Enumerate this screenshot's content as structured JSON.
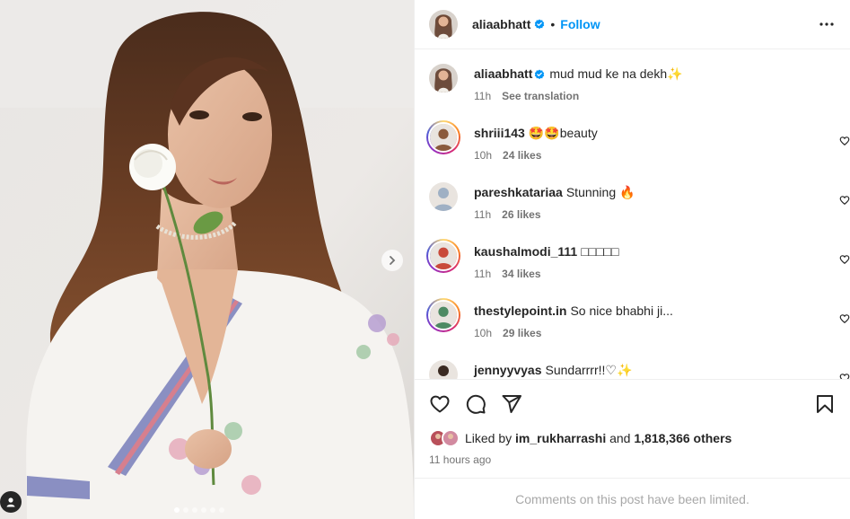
{
  "post": {
    "author": "aliaabhatt",
    "follow_label": "Follow",
    "separator": "•",
    "caption_text": "mud mud ke na dekh",
    "caption_emoji": "✨",
    "caption_time": "11h",
    "see_translation": "See translation",
    "carousel": {
      "slide_count": 6,
      "active_index": 0
    }
  },
  "comments": [
    {
      "user": "shriii143",
      "text": "🤩🤩beauty",
      "time": "10h",
      "likes": "24 likes",
      "story_ring": true,
      "av": "#8a5a3c"
    },
    {
      "user": "pareshkatariaa",
      "text": "Stunning 🔥",
      "time": "11h",
      "likes": "26 likes",
      "story_ring": false,
      "av": "#9fb0c4"
    },
    {
      "user": "kaushalmodi_111",
      "text": "□□□□□",
      "time": "11h",
      "likes": "34 likes",
      "story_ring": true,
      "av": "#c94a3a"
    },
    {
      "user": "thestylepoint.in",
      "text": "So nice bhabhi ji...",
      "time": "10h",
      "likes": "29 likes",
      "story_ring": true,
      "av": "#4e8a63"
    },
    {
      "user": "jennyyvyas",
      "text": "Sundarrrr!!♡✨",
      "time": "",
      "likes": "",
      "story_ring": false,
      "av": "#3a2a22"
    }
  ],
  "likes": {
    "prefix": "Liked by",
    "user": "im_rukharrashi",
    "conj": "and",
    "others": "1,818,366 others"
  },
  "time_ago": "11 hours ago",
  "limited_notice": "Comments on this post have been limited.",
  "colors": {
    "accent": "#0095f6",
    "verified": "#0095f6",
    "muted": "#737373",
    "border": "#efefef"
  }
}
